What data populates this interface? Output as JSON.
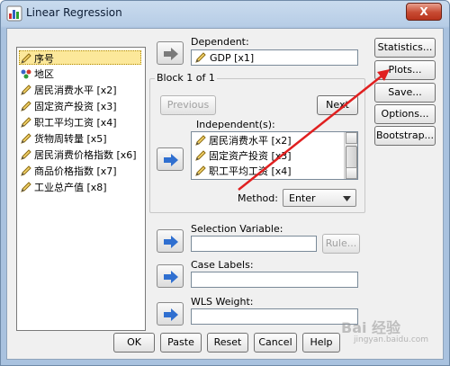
{
  "window": {
    "title": "Linear Regression",
    "close_label": "X"
  },
  "variables": {
    "items": [
      {
        "label": "序号",
        "icon": "pencil-icon",
        "selected": true
      },
      {
        "label": "地区",
        "icon": "nominal-people-icon",
        "selected": false
      },
      {
        "label": "居民消费水平 [x2]",
        "icon": "pencil-icon",
        "selected": false
      },
      {
        "label": "固定资产投资 [x3]",
        "icon": "pencil-icon",
        "selected": false
      },
      {
        "label": "职工平均工资 [x4]",
        "icon": "pencil-icon",
        "selected": false
      },
      {
        "label": "货物周转量 [x5]",
        "icon": "pencil-icon",
        "selected": false
      },
      {
        "label": "居民消费价格指数 [x6]",
        "icon": "pencil-icon",
        "selected": false
      },
      {
        "label": "商品价格指数 [x7]",
        "icon": "pencil-icon",
        "selected": false
      },
      {
        "label": "工业总产值 [x8]",
        "icon": "pencil-icon",
        "selected": false
      }
    ]
  },
  "dependent": {
    "label": "Dependent:",
    "value": "GDP [x1]"
  },
  "block": {
    "title": "Block 1 of 1",
    "previous": "Previous",
    "next": "Next"
  },
  "independents": {
    "label": "Independent(s):",
    "items": [
      "居民消费水平 [x2]",
      "固定资产投资 [x3]",
      "职工平均工资 [x4]"
    ]
  },
  "method": {
    "label": "Method:",
    "value": "Enter"
  },
  "selection": {
    "label": "Selection Variable:",
    "rule": "Rule..."
  },
  "case_labels": {
    "label": "Case Labels:"
  },
  "wls": {
    "label": "WLS Weight:"
  },
  "side_buttons": {
    "statistics": "Statistics...",
    "plots": "Plots...",
    "save": "Save...",
    "options": "Options...",
    "bootstrap": "Bootstrap..."
  },
  "bottom_buttons": {
    "ok": "OK",
    "paste": "Paste",
    "reset": "Reset",
    "cancel": "Cancel",
    "help": "Help"
  },
  "watermark": {
    "text": "Bai 经验",
    "url": "jingyan.baidu.com"
  },
  "colors": {
    "accent_arrow": "#e02020",
    "selected_bg": "#fce89a",
    "arrow_blue": "#2f6fd0"
  }
}
